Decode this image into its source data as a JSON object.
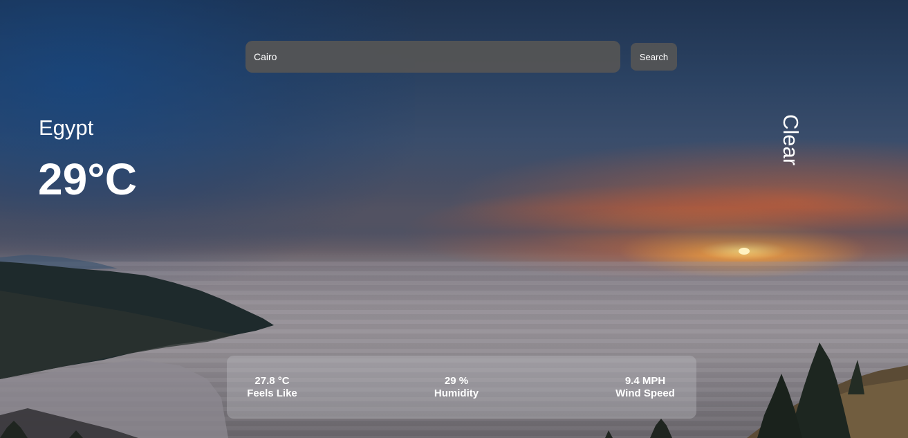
{
  "search": {
    "query": "Cairo",
    "button_label": "Search"
  },
  "current": {
    "location": "Egypt",
    "temperature": "29°C",
    "description": "Clear"
  },
  "stats": {
    "feels_like": {
      "value": "27.8 °C",
      "label": "Feels Like"
    },
    "humidity": {
      "value": "29 %",
      "label": "Humidity"
    },
    "wind_speed": {
      "value": "9.4 MPH",
      "label": "Wind Speed"
    }
  },
  "background": {
    "scene": "sunset over sea of clouds",
    "sun_color": "#ffd27a",
    "sky_color": "#2b4262"
  }
}
